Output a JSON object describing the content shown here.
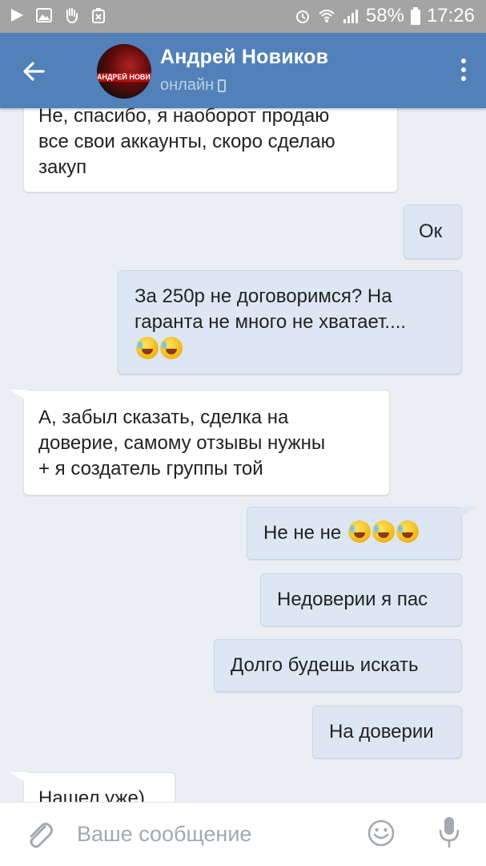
{
  "status_bar": {
    "battery": "58%",
    "time": "17:26"
  },
  "header": {
    "contact_name": "Андрей Новиков",
    "status": "онлайн",
    "avatar_text": "АНДРЕЙ НОВИКОВ"
  },
  "messages": [
    {
      "side": "in",
      "text": "Не, спасибо, я наоборот продаю\nвсе свои аккаунты, скоро сделаю\nзакуп",
      "emoji_count": 0
    },
    {
      "side": "out",
      "text": "Ок",
      "emoji_count": 0
    },
    {
      "side": "out",
      "text": "За 250р не договоримся? На\nгаранта не много не хватает....",
      "emoji_count": 2
    },
    {
      "side": "in",
      "text": "А, забыл сказать, сделка на\nдоверие, самому отзывы нужны\n+ я создатель группы той",
      "emoji_count": 0
    },
    {
      "side": "out",
      "text": "Не не не",
      "emoji_count": 3
    },
    {
      "side": "out",
      "text": "Недоверии я пас",
      "emoji_count": 0
    },
    {
      "side": "out",
      "text": "Долго будешь искать",
      "emoji_count": 0
    },
    {
      "side": "out",
      "text": "На доверии",
      "emoji_count": 0
    },
    {
      "side": "in",
      "text": "Нашел уже)",
      "emoji_count": 0
    }
  ],
  "input": {
    "placeholder": "Ваше сообщение"
  },
  "icons": {
    "back": "arrow-left-icon",
    "menu": "more-vertical-icon",
    "attach": "paperclip-icon",
    "emoji": "smiley-icon",
    "mic": "microphone-icon"
  },
  "colors": {
    "header": "#5181b8",
    "status_bar": "#a4a4a4",
    "chat_background": "#ebeef2",
    "incoming_bubble": "#ffffff",
    "outgoing_bubble": "#dce7f3"
  }
}
